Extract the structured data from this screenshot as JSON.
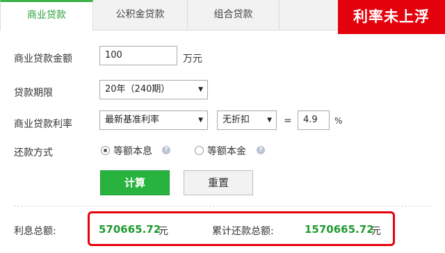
{
  "tabs": [
    {
      "label": "商业贷款",
      "active": true
    },
    {
      "label": "公积金贷款",
      "active": false
    },
    {
      "label": "组合贷款",
      "active": false
    }
  ],
  "banner": "利率未上浮",
  "form": {
    "amount": {
      "label": "商业贷款金额",
      "value": "100",
      "unit": "万元"
    },
    "term": {
      "label": "贷款期限",
      "selected": "20年（240期）"
    },
    "rate": {
      "label": "商业贷款利率",
      "type_selected": "最新基准利率",
      "discount_selected": "无折扣",
      "equals": "=",
      "value": "4.9",
      "unit": "%"
    },
    "repay": {
      "label": "还款方式",
      "options": [
        {
          "label": "等额本息",
          "checked": true
        },
        {
          "label": "等额本金",
          "checked": false
        }
      ]
    }
  },
  "buttons": {
    "calculate": "计算",
    "reset": "重置"
  },
  "results": {
    "interest_label": "利息总额:",
    "interest_value": "570665.72",
    "interest_unit": "元",
    "total_label": "累计还款总额:",
    "total_value": "1570665.72",
    "total_unit": "元"
  },
  "colors": {
    "accent": "#27b33e",
    "alert": "#e4010c",
    "result": "#1f9a2f"
  }
}
